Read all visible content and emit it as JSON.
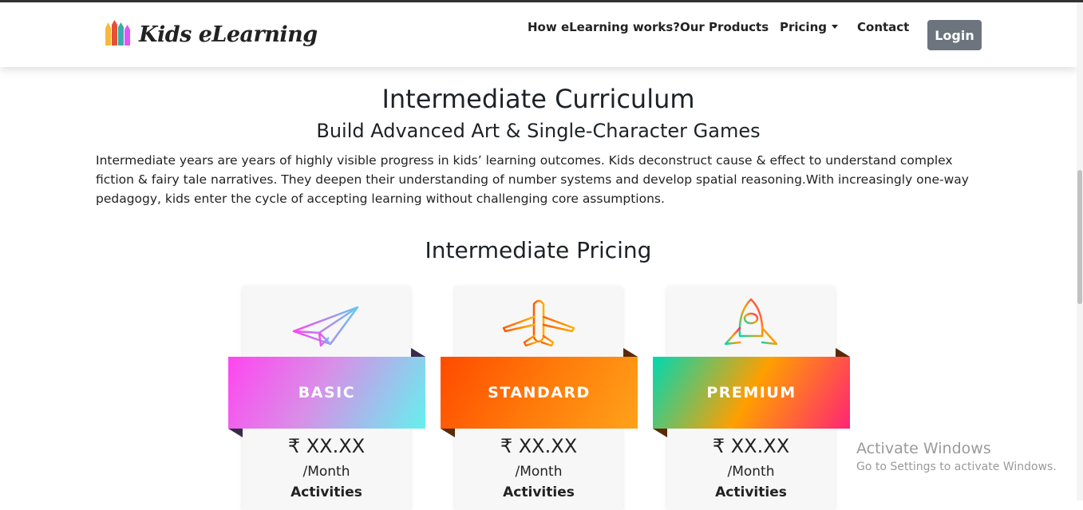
{
  "brand": {
    "name": "Kids eLearning",
    "logo_icon": "pencils-icon"
  },
  "nav": {
    "items": [
      {
        "label": "How eLearning works?"
      },
      {
        "label": "Our Products"
      },
      {
        "label": "Pricing",
        "has_dropdown": true
      },
      {
        "label": "Contact"
      }
    ],
    "login_label": "Login"
  },
  "hero": {
    "title": "Intermediate Curriculum",
    "subtitle": "Build Advanced Art & Single-Character Games",
    "description": "Intermediate years are years of highly visible progress in kids’ learning outcomes. Kids deconstruct cause & effect to understand complex fiction & fairy tale narratives. They deepen their understanding of number systems and develop spatial reasoning.With increasingly one-way pedagogy, kids enter the cycle of accepting learning without challenging core assumptions."
  },
  "pricing": {
    "title": "Intermediate Pricing",
    "plans": [
      {
        "name": "BASIC",
        "icon": "paper-plane-icon",
        "price": "₹ XX.XX",
        "period": "/Month",
        "features_heading": "Activities"
      },
      {
        "name": "STANDARD",
        "icon": "airplane-icon",
        "price": "₹ XX.XX",
        "period": "/Month",
        "features_heading": "Activities"
      },
      {
        "name": "PREMIUM",
        "icon": "rocket-icon",
        "price": "₹ XX.XX",
        "period": "/Month",
        "features_heading": "Activities"
      }
    ]
  },
  "watermark": {
    "line1": "Activate Windows",
    "line2": "Go to Settings to activate Windows."
  },
  "colors": {
    "basic_gradient": [
      "#ff45f0",
      "#63f1ee"
    ],
    "standard_gradient": [
      "#ff4b00",
      "#ff9f1a"
    ],
    "premium_gradient": [
      "#00d8b0",
      "#ff9f00",
      "#ff2474"
    ],
    "login_bg": "#6c757d"
  }
}
